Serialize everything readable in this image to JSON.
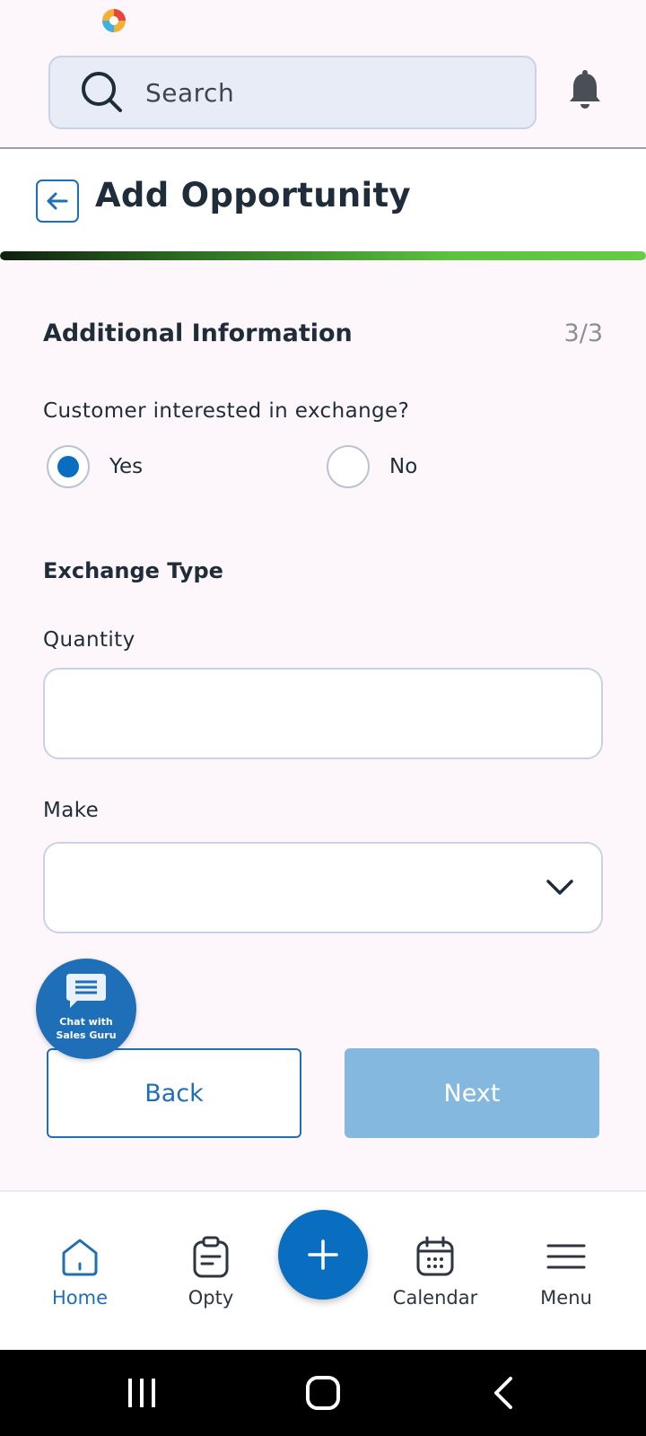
{
  "search": {
    "placeholder": "Search"
  },
  "header": {
    "title": "Add Opportunity"
  },
  "progress": {
    "percent": 100
  },
  "form": {
    "section_title": "Additional Information",
    "step": "3/3",
    "question": "Customer interested in exchange?",
    "options": [
      {
        "label": "Yes",
        "selected": true
      },
      {
        "label": "No",
        "selected": false
      }
    ],
    "subsection": "Exchange Type",
    "quantity_label": "Quantity",
    "quantity_value": "",
    "make_label": "Make",
    "make_value": ""
  },
  "chat": {
    "line1": "Chat with",
    "line2": "Sales Guru"
  },
  "buttons": {
    "back": "Back",
    "next": "Next"
  },
  "nav": [
    {
      "label": "Home",
      "icon": "home-icon",
      "active": true
    },
    {
      "label": "Opty",
      "icon": "clipboard-icon",
      "active": false
    },
    {
      "label": "Calendar",
      "icon": "calendar-icon",
      "active": false
    },
    {
      "label": "Menu",
      "icon": "hamburger-icon",
      "active": false
    }
  ],
  "colors": {
    "accent": "#0a6ec0",
    "progress_end": "#66cc44",
    "next_disabled": "#85b8de"
  }
}
